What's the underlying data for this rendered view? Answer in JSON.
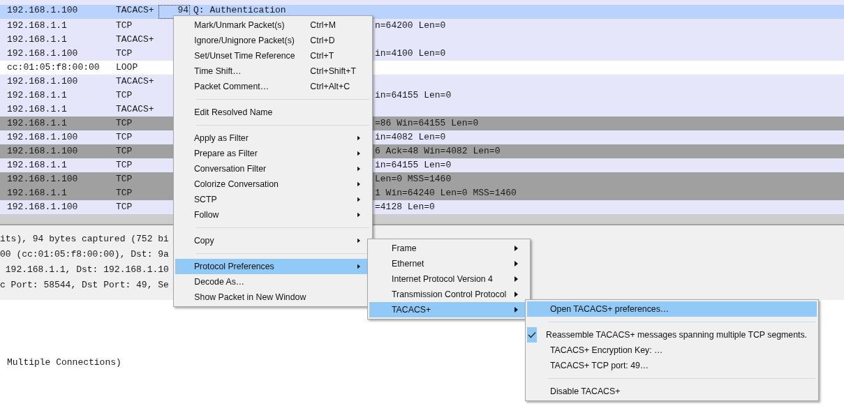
{
  "packet_list": {
    "rows": [
      {
        "source": "192.168.1.100",
        "protocol": "TACACS+",
        "length": "94",
        "info": "Q: Authentication",
        "selected": true
      },
      {
        "source": "192.168.1.1",
        "protocol": "TCP",
        "tail": "n=64200 Len=0",
        "color": "#e6e6fa",
        "selected": false
      },
      {
        "source": "192.168.1.1",
        "protocol": "TACACS+",
        "color": "#e6e6fa",
        "selected": false
      },
      {
        "source": "192.168.1.100",
        "protocol": "TCP",
        "tail": "in=4100 Len=0",
        "color": "#e6e6fa",
        "selected": false
      },
      {
        "source": "cc:01:05:f8:00:00",
        "protocol": "LOOP",
        "color": "#ffffff",
        "selected": false
      },
      {
        "source": "192.168.1.100",
        "protocol": "TACACS+",
        "color": "#e6e6fa",
        "selected": false
      },
      {
        "source": "192.168.1.1",
        "protocol": "TCP",
        "tail": "in=64155 Len=0",
        "color": "#e6e6fa",
        "selected": false
      },
      {
        "source": "192.168.1.1",
        "protocol": "TACACS+",
        "color": "#e6e6fa",
        "selected": false
      },
      {
        "source": "192.168.1.1",
        "protocol": "TCP",
        "tail": "=86 Win=64155 Len=0",
        "color": "#a0a0a0",
        "selected": false
      },
      {
        "source": "192.168.1.100",
        "protocol": "TCP",
        "tail": "in=4082 Len=0",
        "color": "#e6e6fa",
        "selected": false
      },
      {
        "source": "192.168.1.100",
        "protocol": "TCP",
        "tail": "6 Ack=48 Win=4082 Len=0",
        "color": "#a0a0a0",
        "selected": false
      },
      {
        "source": "192.168.1.1",
        "protocol": "TCP",
        "tail": "in=64155 Len=0",
        "color": "#e6e6fa",
        "selected": false
      },
      {
        "source": "192.168.1.100",
        "protocol": "TCP",
        "tail": "Len=0 MSS=1460",
        "color": "#a0a0a0",
        "selected": false
      },
      {
        "source": "192.168.1.1",
        "protocol": "TCP",
        "tail": "1 Win=64240 Len=0 MSS=1460",
        "color": "#a0a0a0",
        "selected": false
      },
      {
        "source": "192.168.1.100",
        "protocol": "TCP",
        "tail": "=4128 Len=0",
        "color": "#e6e6fa",
        "selected": false
      }
    ]
  },
  "details": {
    "lines": [
      "its), 94 bytes captured (752 bi",
      "00 (cc:01:05:f8:00:00), Dst: 9a",
      " 192.168.1.1, Dst: 192.168.1.10",
      "c Port: 58544, Dst Port: 49, Se"
    ]
  },
  "bytes": {
    "lines": [
      "Multiple Connections)"
    ]
  },
  "context_menu": {
    "items": [
      {
        "kind": "item",
        "label": "Mark/Unmark Packet(s)",
        "shortcut": "Ctrl+M",
        "submenu": false,
        "selected": false
      },
      {
        "kind": "item",
        "label": "Ignore/Unignore Packet(s)",
        "shortcut": "Ctrl+D",
        "submenu": false,
        "selected": false
      },
      {
        "kind": "item",
        "label": "Set/Unset Time Reference",
        "shortcut": "Ctrl+T",
        "submenu": false,
        "selected": false
      },
      {
        "kind": "item",
        "label": "Time Shift…",
        "shortcut": "Ctrl+Shift+T",
        "submenu": false,
        "selected": false
      },
      {
        "kind": "item",
        "label": "Packet Comment…",
        "shortcut": "Ctrl+Alt+C",
        "submenu": false,
        "selected": false
      },
      {
        "kind": "separator"
      },
      {
        "kind": "item",
        "label": "Edit Resolved Name",
        "submenu": false,
        "selected": false
      },
      {
        "kind": "separator"
      },
      {
        "kind": "item",
        "label": "Apply as Filter",
        "submenu": true,
        "selected": false
      },
      {
        "kind": "item",
        "label": "Prepare as Filter",
        "submenu": true,
        "selected": false
      },
      {
        "kind": "item",
        "label": "Conversation Filter",
        "submenu": true,
        "selected": false
      },
      {
        "kind": "item",
        "label": "Colorize Conversation",
        "submenu": true,
        "selected": false
      },
      {
        "kind": "item",
        "label": "SCTP",
        "submenu": true,
        "selected": false
      },
      {
        "kind": "item",
        "label": "Follow",
        "submenu": true,
        "selected": false
      },
      {
        "kind": "separator"
      },
      {
        "kind": "item",
        "label": "Copy",
        "submenu": true,
        "selected": false
      },
      {
        "kind": "separator"
      },
      {
        "kind": "item",
        "label": "Protocol Preferences",
        "submenu": true,
        "selected": true
      },
      {
        "kind": "item",
        "label": "Decode As…",
        "submenu": false,
        "selected": false
      },
      {
        "kind": "item",
        "label": "Show Packet in New Window",
        "submenu": false,
        "selected": false
      }
    ]
  },
  "protocol_submenu": {
    "items": [
      {
        "kind": "item",
        "label": "Frame",
        "submenu": true,
        "selected": false
      },
      {
        "kind": "item",
        "label": "Ethernet",
        "submenu": true,
        "selected": false
      },
      {
        "kind": "item",
        "label": "Internet Protocol Version 4",
        "submenu": true,
        "selected": false
      },
      {
        "kind": "item",
        "label": "Transmission Control Protocol",
        "submenu": true,
        "selected": false
      },
      {
        "kind": "item",
        "label": "TACACS+",
        "submenu": true,
        "selected": true
      }
    ]
  },
  "tacacs_submenu": {
    "items": [
      {
        "kind": "item",
        "label": "Open TACACS+ preferences…",
        "submenu": false,
        "selected": true,
        "checked": false
      },
      {
        "kind": "separator"
      },
      {
        "kind": "item",
        "label": "Reassemble TACACS+ messages spanning multiple TCP segments.",
        "submenu": false,
        "selected": false,
        "checked": true
      },
      {
        "kind": "item",
        "label": "TACACS+ Encryption Key: …",
        "submenu": false,
        "selected": false,
        "checked": false
      },
      {
        "kind": "item",
        "label": "TACACS+ TCP port: 49…",
        "submenu": false,
        "selected": false,
        "checked": false
      },
      {
        "kind": "separator"
      },
      {
        "kind": "item",
        "label": "Disable TACACS+",
        "submenu": false,
        "selected": false,
        "checked": false
      }
    ]
  }
}
